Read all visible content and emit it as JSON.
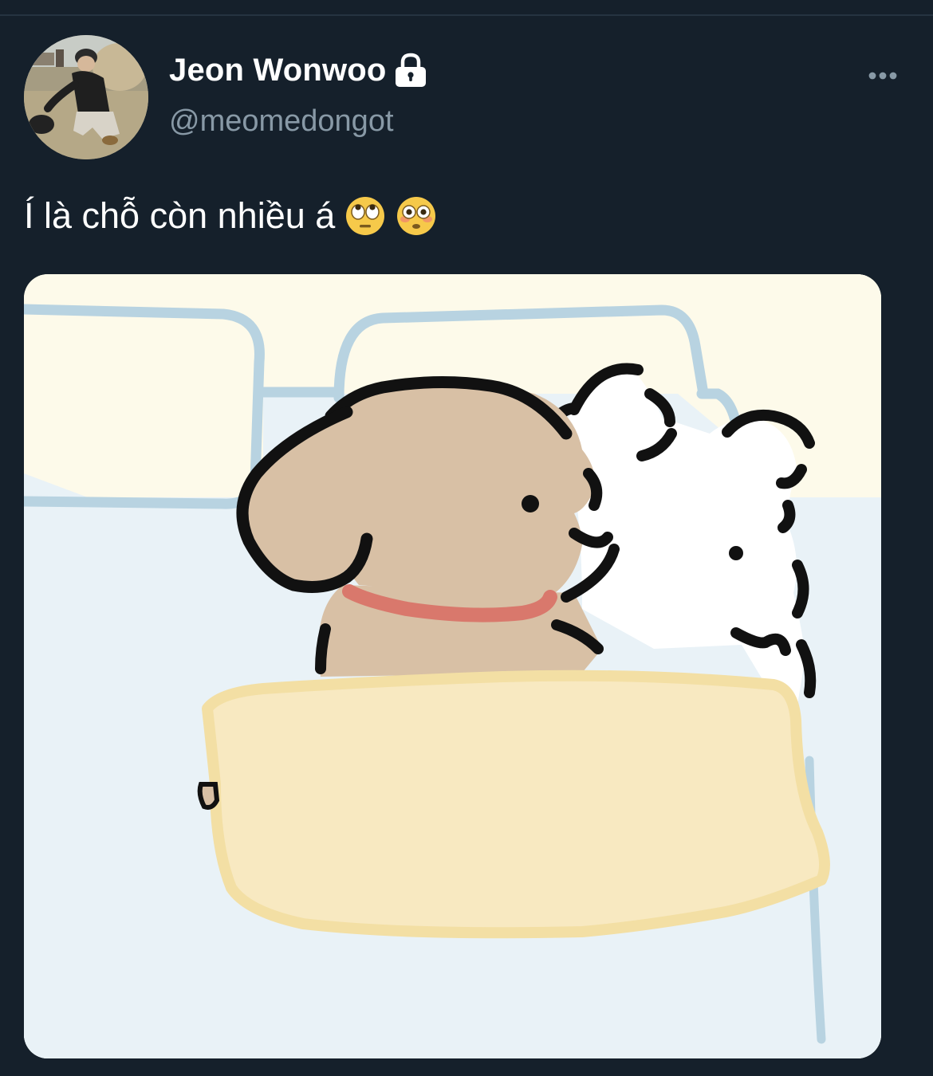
{
  "tweet": {
    "display_name": "Jeon Wonwoo",
    "protected": true,
    "handle": "@meomedongot",
    "text": "Í là chỗ còn nhiều á",
    "emojis": [
      "face-with-rolling-eyes",
      "flushed-face"
    ],
    "media": {
      "kind": "illustration",
      "subject": "cartoon brown puppy with red collar and white fluffy dog lying in bed under yellow blanket"
    }
  },
  "theme": {
    "background": "#15202b",
    "name_color": "#ffffff",
    "handle_color": "#8899a6",
    "text_color": "#ffffff"
  }
}
